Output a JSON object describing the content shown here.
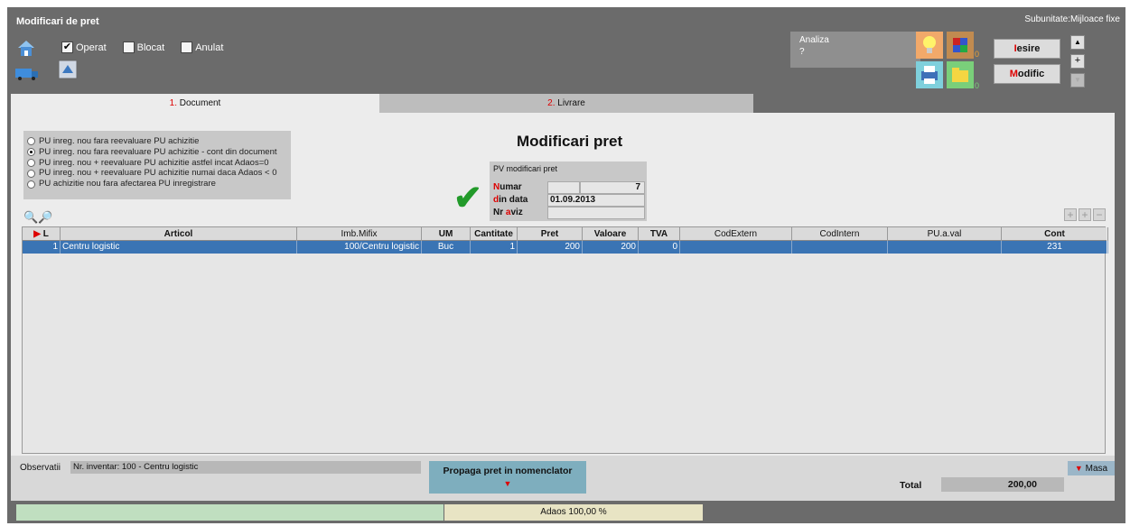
{
  "window": {
    "title": "Modificari de pret",
    "subunit": "Subunitate:Mijloace fixe"
  },
  "toolbar": {
    "checkboxes": [
      {
        "label": "Operat",
        "checked": true
      },
      {
        "label": "Blocat",
        "checked": false
      },
      {
        "label": "Anulat",
        "checked": false
      }
    ],
    "analiza_label": "Analiza",
    "analiza_value": "?",
    "bulb_count": "0",
    "folder_count": "0",
    "iesire_first": "I",
    "iesire_rest": "esire",
    "modific_first": "M",
    "modific_rest": "odific",
    "up_icon": "▲",
    "plus_icon": "+",
    "down_icon": "▼"
  },
  "tabs": [
    {
      "num": "1.",
      "label": " Document",
      "active": true
    },
    {
      "num": "2.",
      "label": " Livrare",
      "active": false
    }
  ],
  "options": [
    {
      "label": "PU inreg. nou  fara reevaluare PU achizitie",
      "selected": false
    },
    {
      "label": "PU inreg. nou  fara reevaluare PU achizitie - cont din document",
      "selected": true
    },
    {
      "label": "PU inreg. nou  + reevaluare PU achizitie astfel incat Adaos=0",
      "selected": false
    },
    {
      "label": "PU inreg. nou  + reevaluare PU achizitie numai daca Adaos < 0",
      "selected": false
    },
    {
      "label": "PU achizitie nou fara afectarea PU inregistrare",
      "selected": false
    }
  ],
  "document": {
    "heading": "Modificari pret",
    "pv_label": "PV modificari pret",
    "numar_first": "N",
    "numar_rest": "umar",
    "numar_value": "7",
    "data_first": "d",
    "data_rest": "in data",
    "data_value": "01.09.2013",
    "aviz_prefix": "Nr ",
    "aviz_first": "a",
    "aviz_rest": "viz",
    "aviz_value": ""
  },
  "grid": {
    "columns": [
      "L",
      "Articol",
      "Imb.Mifix",
      "UM",
      "Cantitate",
      "Pret",
      "Valoare",
      "TVA",
      "CodExtern",
      "CodIntern",
      "PU.a.val",
      "Cont"
    ],
    "rows": [
      {
        "L": "1",
        "Articol": "Centru logistic",
        "Imb": "100/Centru logistic",
        "UM": "Buc",
        "Cantitate": "1",
        "Pret": "200",
        "Valoare": "200",
        "TVA": "0",
        "CodExtern": "",
        "CodIntern": "",
        "PUaval": "",
        "Cont": "231"
      }
    ]
  },
  "footer": {
    "observatii_label": "Observatii",
    "observatii_value": "Nr. inventar: 100 - Centru logistic",
    "propaga_label": "Propaga pret in nomenclator",
    "masa_label": "Masa",
    "total_label": "Total",
    "total_value": "200,00"
  },
  "status": {
    "adaos": "Adaos 100,00 %"
  },
  "colors": {
    "row_selected": "#3a74b4",
    "accent_red": "#d00000",
    "check_green": "#229a2a"
  }
}
